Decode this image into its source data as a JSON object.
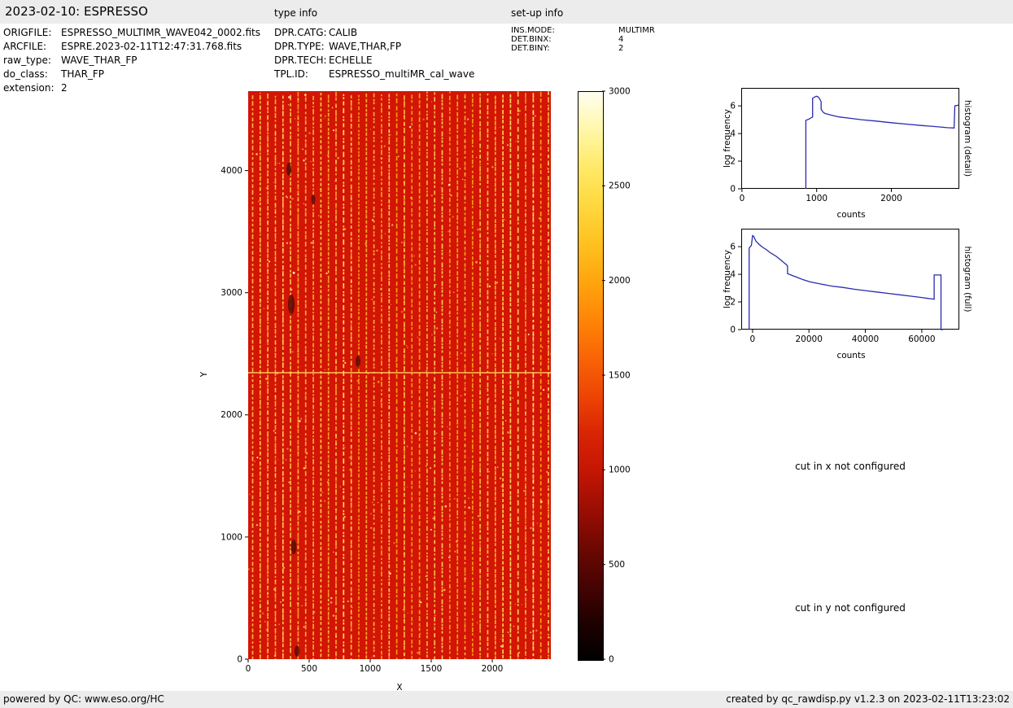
{
  "header": {
    "title": "2023-02-10: ESPRESSO",
    "type_info": "type info",
    "setup_info": "set-up info"
  },
  "metadata": {
    "file_info": [
      {
        "label": "ORIGFILE:",
        "value": "ESPRESSO_MULTIMR_WAVE042_0002.fits"
      },
      {
        "label": "ARCFILE:",
        "value": "ESPRE.2023-02-11T12:47:31.768.fits"
      },
      {
        "label": "raw_type:",
        "value": "WAVE_THAR_FP"
      },
      {
        "label": "do_class:",
        "value": "THAR_FP"
      },
      {
        "label": "extension:",
        "value": "2"
      }
    ],
    "type_info": [
      {
        "label": "DPR.CATG:",
        "value": "CALIB"
      },
      {
        "label": "DPR.TYPE:",
        "value": "WAVE,THAR,FP"
      },
      {
        "label": "DPR.TECH:",
        "value": "ECHELLE"
      },
      {
        "label": "TPL.ID:",
        "value": "ESPRESSO_multiMR_cal_wave"
      }
    ],
    "setup_info": [
      {
        "label": "INS.MODE:",
        "value": "MULTIMR"
      },
      {
        "label": "DET.BINX:",
        "value": "4"
      },
      {
        "label": "DET.BINY:",
        "value": "2"
      }
    ]
  },
  "messages": {
    "cut_x": "cut in x not configured",
    "cut_y": "cut in y not configured"
  },
  "footer": {
    "left": "powered by QC: www.eso.org/HC",
    "right": "created by qc_rawdisp.py v1.2.3 on 2023-02-11T13:23:02"
  },
  "chart_data": [
    {
      "name": "raw_frame_image",
      "type": "heatmap",
      "xlabel": "X",
      "ylabel": "Y",
      "xlim": [
        0,
        2480
      ],
      "ylim": [
        0,
        4650
      ],
      "xticks": [
        0,
        500,
        1000,
        1500,
        2000
      ],
      "yticks": [
        0,
        1000,
        2000,
        3000,
        4000
      ],
      "horizontal_line_y": 2350,
      "description": "Raw ESPRESSO echelle calibration frame: red background near 1000 counts with about 40 bright dotted vertical spectral-order stripes, scattered bright emission-line dots, one bright horizontal line near y=2350 and a few dark blemishes near the left edge",
      "colors": {
        "background": "#d21505",
        "stripes": [
          "#ffc93a",
          "#ffbb26",
          "#ffd24e",
          "#ffaa16",
          "#ffe068"
        ],
        "sparkle": "#fff6b0",
        "dots": [
          "#ffe26a",
          "#ffd24a",
          "#fff8c0",
          "#ffaa30"
        ],
        "blemish": "#5c0e04",
        "horizontal_line": "#ffd75e"
      },
      "colorbar": {
        "vmin": 0,
        "vmax": 3000,
        "ticks": [
          0,
          500,
          1000,
          1500,
          2000,
          2500,
          3000
        ],
        "gradient": [
          [
            0,
            "#000000"
          ],
          [
            200,
            "#1f0100"
          ],
          [
            400,
            "#470402"
          ],
          [
            600,
            "#700802"
          ],
          [
            800,
            "#9c0e03"
          ],
          [
            1000,
            "#c41604"
          ],
          [
            1200,
            "#da2505"
          ],
          [
            1400,
            "#ee4605"
          ],
          [
            1600,
            "#f96506"
          ],
          [
            1800,
            "#ff8607"
          ],
          [
            2000,
            "#ffa50e"
          ],
          [
            2200,
            "#ffc120"
          ],
          [
            2400,
            "#ffd83e"
          ],
          [
            2600,
            "#ffe968"
          ],
          [
            2800,
            "#fff7a8"
          ],
          [
            3000,
            "#fffef0"
          ]
        ]
      }
    },
    {
      "name": "histogram_detail",
      "type": "line",
      "xlabel": "counts",
      "ylabel": "log frequency",
      "right_label": "histogram (detail)",
      "line_color": "#2a2ab0",
      "xlim": [
        -10,
        2910
      ],
      "ylim": [
        0,
        7.3
      ],
      "xticks": [
        0,
        1000,
        2000
      ],
      "yticks": [
        0,
        2,
        4,
        6
      ],
      "x": [
        855,
        855,
        900,
        930,
        945,
        945,
        995,
        1020,
        1040,
        1060,
        1060,
        1085,
        1110,
        1180,
        1300,
        1450,
        1600,
        1800,
        2000,
        2200,
        2400,
        2600,
        2750,
        2840,
        2850,
        2905
      ],
      "y": [
        0,
        4.95,
        5.05,
        5.15,
        5.2,
        6.55,
        6.7,
        6.65,
        6.5,
        6.3,
        5.75,
        5.55,
        5.45,
        5.35,
        5.2,
        5.1,
        5.0,
        4.9,
        4.78,
        4.68,
        4.58,
        4.5,
        4.42,
        4.4,
        6.0,
        6.05
      ]
    },
    {
      "name": "histogram_full",
      "type": "line",
      "xlabel": "counts",
      "ylabel": "log frequency",
      "right_label": "histogram (full)",
      "line_color": "#2a2ab0",
      "xlim": [
        -4000,
        73300
      ],
      "ylim": [
        0,
        7.3
      ],
      "xticks": [
        0,
        20000,
        40000,
        60000
      ],
      "yticks": [
        0,
        2,
        4,
        6
      ],
      "x": [
        -1200,
        -1200,
        -400,
        0,
        400,
        1200,
        2400,
        3600,
        4800,
        6000,
        7200,
        8400,
        9600,
        10800,
        12000,
        12400,
        12400,
        13600,
        15600,
        18000,
        20400,
        24000,
        28000,
        32000,
        36000,
        40000,
        44000,
        48000,
        52000,
        56000,
        60000,
        62400,
        64400,
        64400,
        66800,
        66800,
        67600
      ],
      "y": [
        0,
        5.9,
        6.1,
        6.8,
        6.75,
        6.4,
        6.15,
        5.95,
        5.8,
        5.6,
        5.45,
        5.3,
        5.1,
        4.9,
        4.7,
        4.6,
        4.05,
        3.95,
        3.8,
        3.6,
        3.45,
        3.3,
        3.15,
        3.05,
        2.92,
        2.82,
        2.72,
        2.62,
        2.52,
        2.42,
        2.32,
        2.25,
        2.2,
        3.95,
        3.95,
        0,
        0
      ]
    }
  ]
}
